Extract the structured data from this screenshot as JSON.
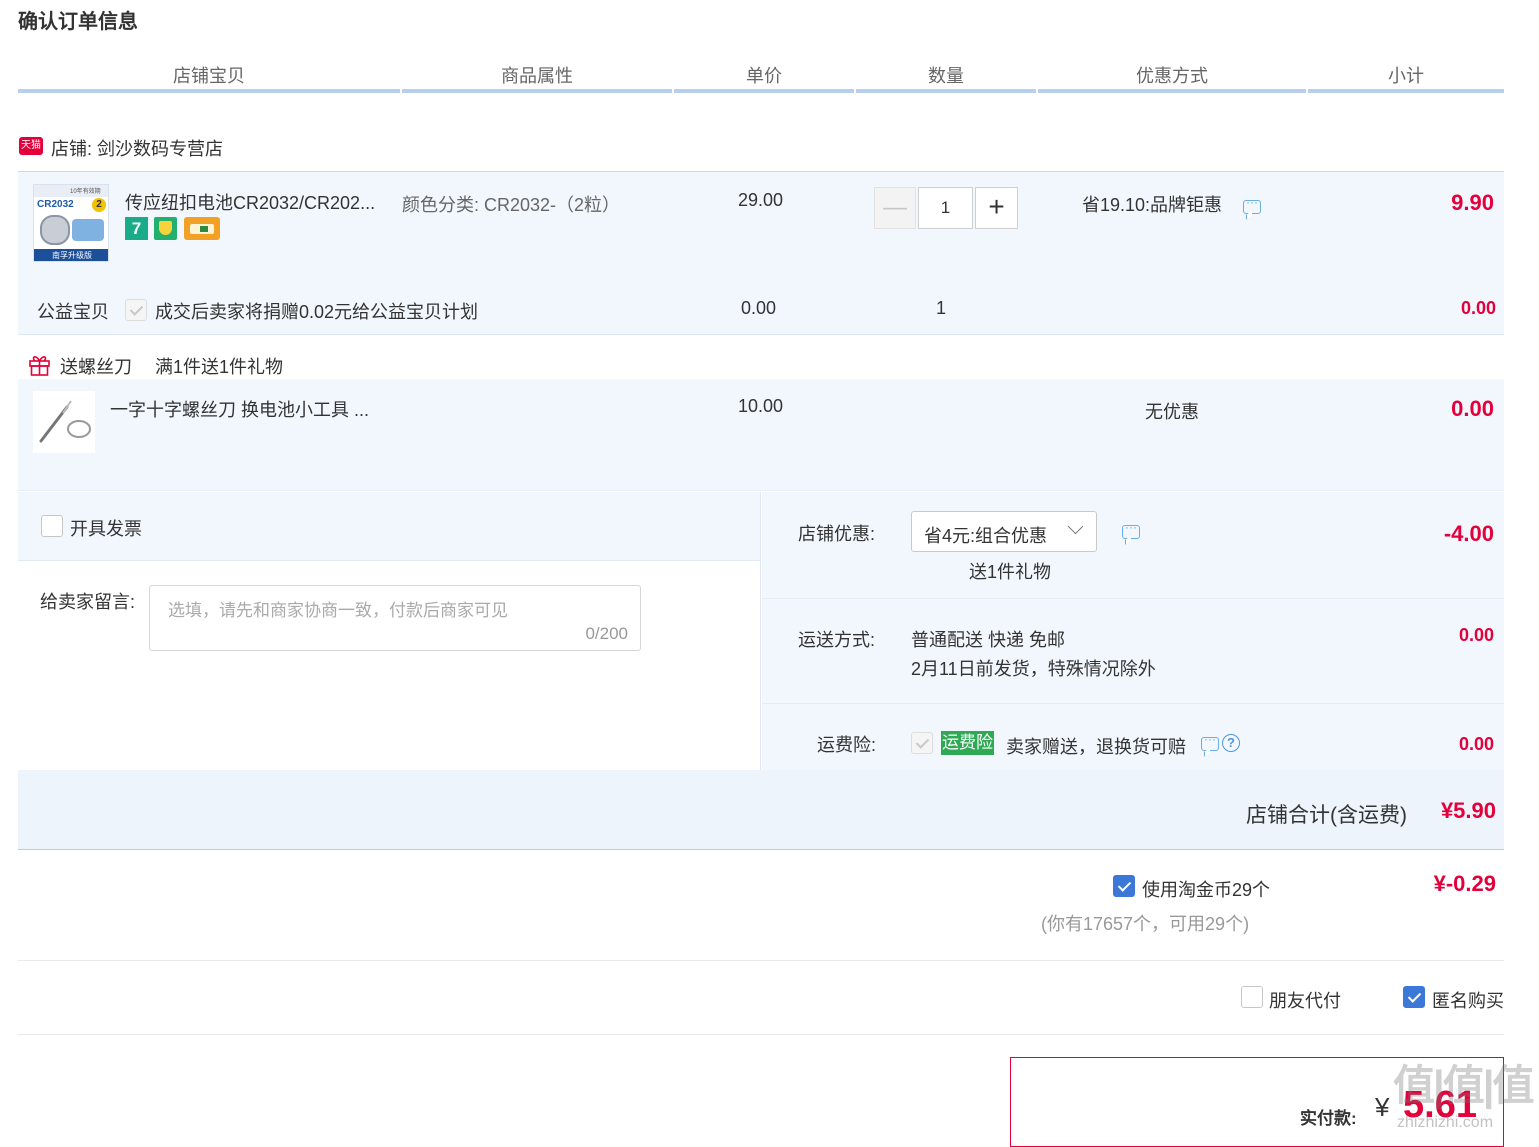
{
  "page_title": "确认订单信息",
  "columns": [
    "店铺宝贝",
    "商品属性",
    "单价",
    "数量",
    "优惠方式",
    "小计"
  ],
  "shop": {
    "badge": "天猫",
    "label": "店铺: 剑沙数码专营店"
  },
  "item": {
    "title": "传应纽扣电池CR2032/CR202...",
    "attr": "颜色分类: CR2032-（2粒）",
    "price": "29.00",
    "qty": "1",
    "discount": "省19.10:品牌钜惠",
    "subtotal": "9.90",
    "thumb_text_top": "CR2032",
    "thumb_text_badge": "2",
    "thumb_text_bottom": "南孚升级版",
    "thumb_text_corner": "10年有效期",
    "badge_seven": "7"
  },
  "charity": {
    "label": "公益宝贝",
    "text": "成交后卖家将捐赠0.02元给公益宝贝计划",
    "price": "0.00",
    "qty": "1",
    "subtotal": "0.00"
  },
  "gift_promo": {
    "title": "送螺丝刀",
    "rule": "满1件送1件礼物"
  },
  "gift_item": {
    "title": "一字十字螺丝刀 换电池小工具 ...",
    "price": "10.00",
    "discount": "无优惠",
    "subtotal": "0.00"
  },
  "invoice": {
    "label": "开具发票"
  },
  "message": {
    "label": "给卖家留言:",
    "placeholder": "选填，请先和商家协商一致，付款后商家可见",
    "counter": "0/200"
  },
  "shop_discount": {
    "label": "店铺优惠:",
    "selected": "省4元:组合优惠",
    "note": "送1件礼物",
    "amount": "-4.00"
  },
  "shipping": {
    "label": "运送方式:",
    "method": "普通配送 快递 免邮",
    "eta": "2月11日前发货，特殊情况除外",
    "amount": "0.00"
  },
  "insurance": {
    "label": "运费险:",
    "tag": "运费险",
    "text": "卖家赠送，退换货可赔",
    "amount": "0.00"
  },
  "shop_total": {
    "label": "店铺合计(含运费)",
    "amount": "¥5.90"
  },
  "coins": {
    "label": "使用淘金币29个",
    "sub": "(你有17657个，可用29个)",
    "amount": "¥-0.29",
    "checked": true
  },
  "options": {
    "friend_pay": "朋友代付",
    "anonymous": "匿名购买",
    "anonymous_checked": true
  },
  "pay": {
    "label": "实付款:",
    "currency": "¥",
    "amount": "5.61"
  },
  "watermark": {
    "big": "值|值|值",
    "small": "zhizhizhi.com"
  },
  "colors": {
    "accent_red": "#e4003a",
    "header_line": "#b7d0ee",
    "panel_bg": "#f2f7fd",
    "check_blue": "#3c78d8",
    "insurance_green": "#2eaa54"
  }
}
